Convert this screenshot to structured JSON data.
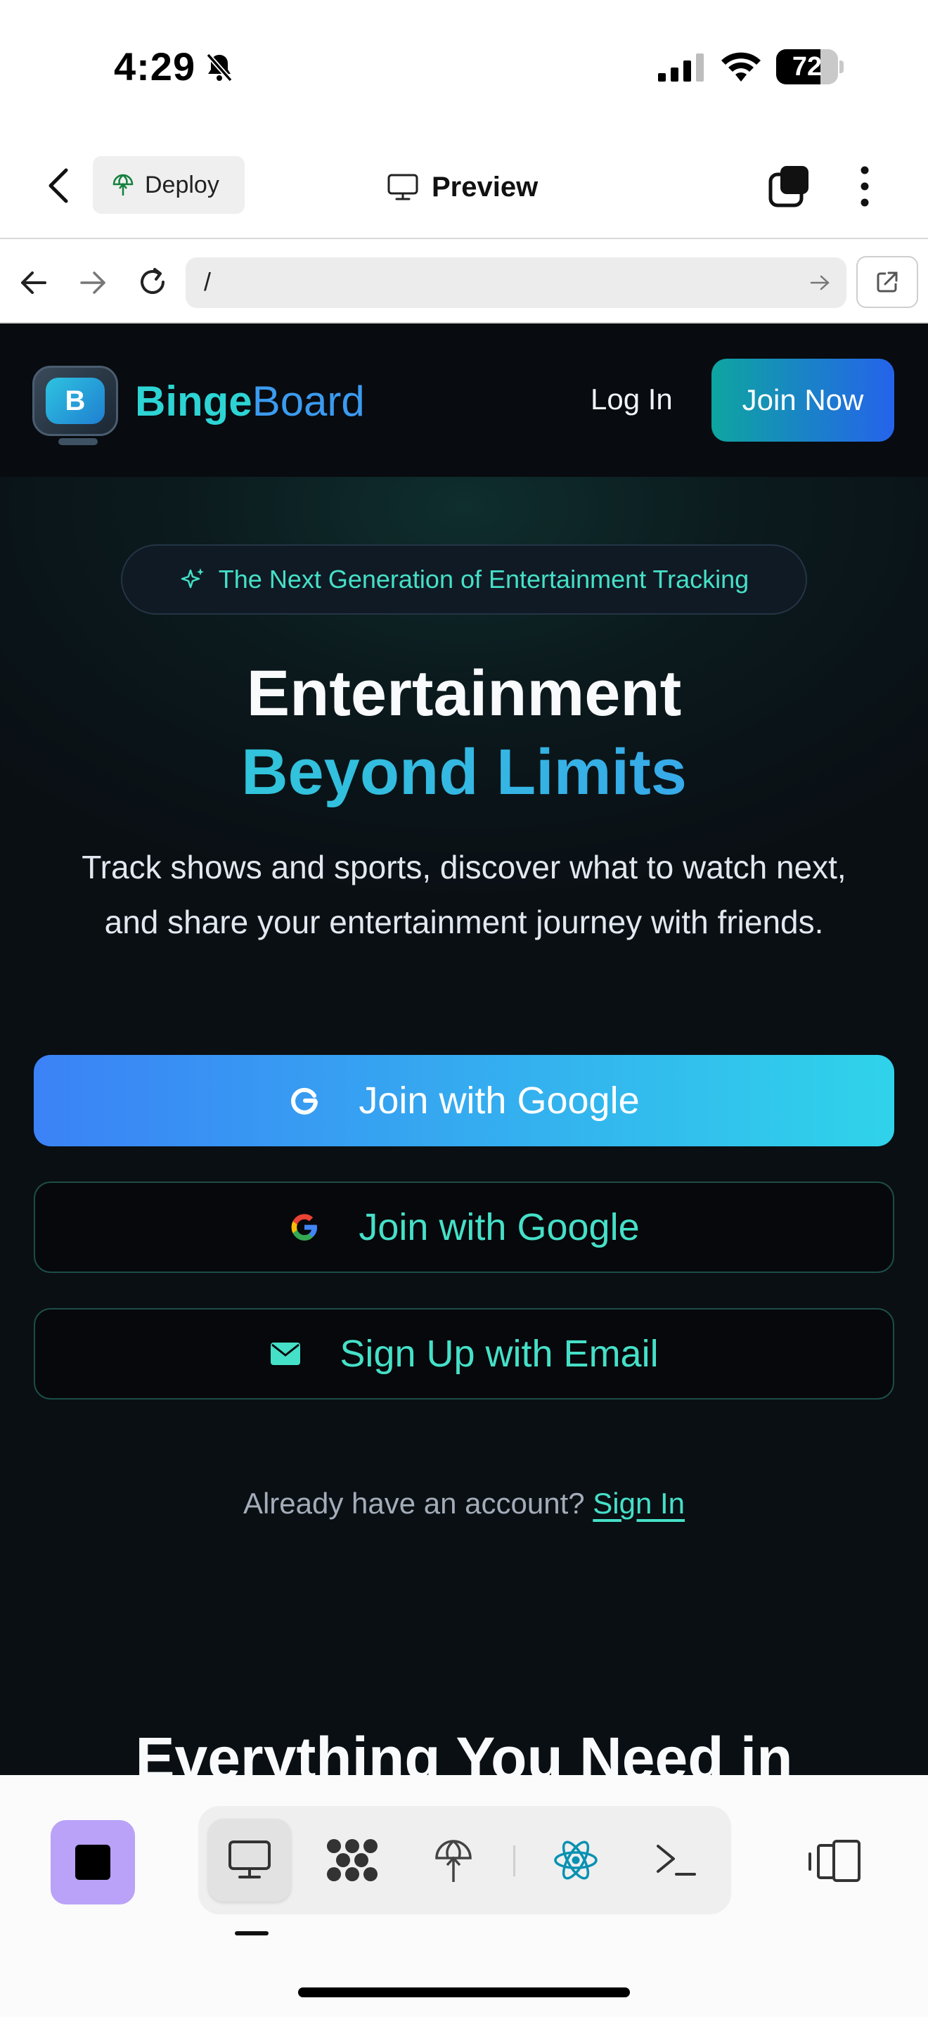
{
  "status_bar": {
    "time": "4:29",
    "battery_level": "72",
    "battery_fraction": 0.72
  },
  "app_header": {
    "deploy_label": "Deploy",
    "preview_label": "Preview"
  },
  "browser": {
    "url": "/"
  },
  "site": {
    "brand_part1": "Binge",
    "brand_part2": "Board",
    "logo_letter": "B",
    "nav": {
      "login": "Log In",
      "join_now": "Join Now"
    },
    "badge_text": "The Next Generation of Entertainment Tracking",
    "hero": {
      "title_line1": "Entertainment",
      "title_line2": "Beyond Limits",
      "subtitle": "Track shows and sports, discover what to watch next, and share your entertainment journey with friends."
    },
    "buttons": {
      "google_primary": "Join with Google",
      "google_outline": "Join with Google",
      "email": "Sign Up with Email"
    },
    "signin_prompt": "Already have an account?",
    "signin_link": "Sign In",
    "section_title": "Everything You Need in"
  },
  "colors": {
    "accent_teal": "#45e0c8",
    "accent_blue": "#3b82f6",
    "stop_button": "#b9a2f8",
    "react_icon": "#0891b2"
  },
  "icons": {
    "status": [
      "bell-slash-icon",
      "cellular-signal-icon",
      "wifi-icon",
      "battery-icon"
    ],
    "header": [
      "chevron-left-icon",
      "deploy-globe-icon",
      "monitor-icon",
      "tabs-icon",
      "more-vertical-icon"
    ],
    "browser": [
      "arrow-left-icon",
      "arrow-right-icon",
      "reload-icon",
      "arrow-right-small-icon",
      "external-link-icon"
    ],
    "toolbar": [
      "stop-icon",
      "monitor-icon",
      "grid-dots-icon",
      "deploy-globe-icon",
      "react-icon",
      "terminal-icon",
      "panel-toggle-icon"
    ]
  }
}
